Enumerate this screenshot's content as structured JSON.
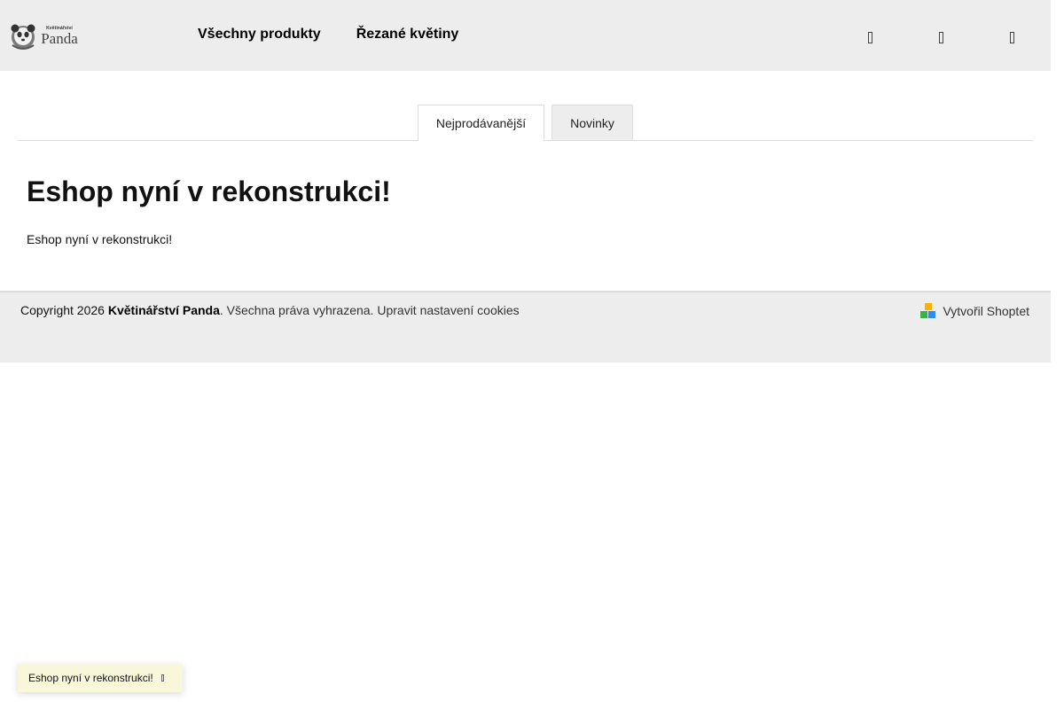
{
  "header": {
    "logo": {
      "top_text": "Květinářství",
      "name": "Panda"
    },
    "nav": [
      {
        "label": "Všechny produkty"
      },
      {
        "label": "Řezané květiny"
      }
    ],
    "icons": [
      "search-icon",
      "user-icon",
      "cart-icon"
    ]
  },
  "tabs": [
    {
      "label": "Nejprodávanější",
      "active": true
    },
    {
      "label": "Novinky",
      "active": false
    }
  ],
  "main": {
    "title": "Eshop nyní v rekonstrukci!",
    "text": "Eshop nyní v rekonstrukci!"
  },
  "footer": {
    "copyright_prefix": "Copyright 2026",
    "brand": "Květinářství Panda",
    "rights": ". Všechna práva vyhrazena.",
    "cookies_link": "Upravit nastavení cookies",
    "credit": "Vytvořil Shoptet"
  },
  "toast": {
    "text": "Eshop nyní v rekonstrukci!"
  },
  "colors": {
    "header_bg": "#ededed",
    "footer_bg": "#ededed",
    "toast_bg": "#f9f7d9"
  }
}
